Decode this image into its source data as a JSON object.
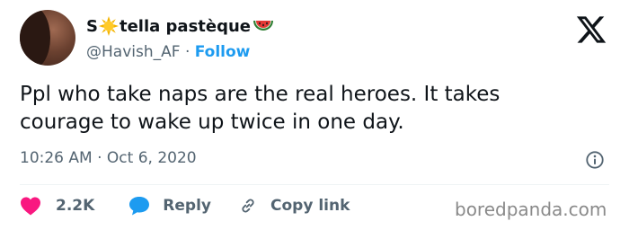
{
  "user": {
    "name_before": "S",
    "name_after": "tella pastèque",
    "handle": "@Havish_AF",
    "separator": "·",
    "follow_label": "Follow"
  },
  "tweet": {
    "line1": "Ppl who take naps are the real heroes. It takes",
    "line2": "courage to wake up twice in one day.",
    "timestamp": "10:26 AM · Oct 6, 2020"
  },
  "actions": {
    "like_count": "2.2K",
    "reply_label": "Reply",
    "copy_link_label": "Copy link"
  },
  "watermark": "boredpanda.com",
  "icons": {
    "brand": "x-logo-icon",
    "name_emoji_1": "sun-icon",
    "name_emoji_2": "watermelon-icon",
    "info": "info-icon",
    "like": "heart-icon",
    "reply": "speech-bubble-icon",
    "copy": "link-icon"
  },
  "colors": {
    "text": "#0f1419",
    "muted": "#536471",
    "link_blue": "#1d9bf0",
    "like_pink": "#f91880",
    "watermark_gray": "#8a8a8a"
  }
}
